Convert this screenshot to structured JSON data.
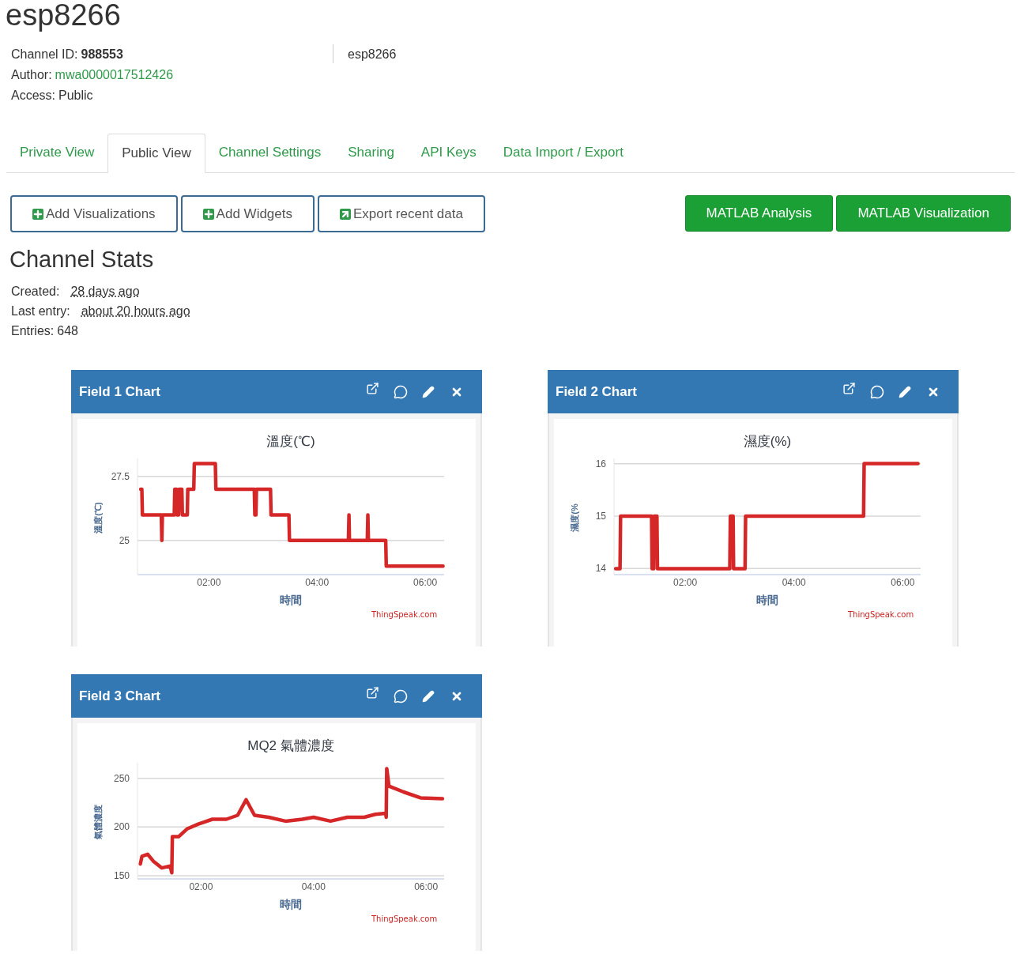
{
  "channel": {
    "title": "esp8266",
    "info": [
      {
        "label": "Channel ID:",
        "value": "988553",
        "kind": "bold"
      },
      {
        "label": "Author:",
        "value": "mwa0000017512426",
        "kind": "link"
      },
      {
        "label": "Access:",
        "value": "Public",
        "kind": "plain"
      }
    ],
    "description": "esp8266"
  },
  "tabs": [
    {
      "label": "Private View",
      "selected": false
    },
    {
      "label": "Public View",
      "selected": true
    },
    {
      "label": "Channel Settings",
      "selected": false
    },
    {
      "label": "Sharing",
      "selected": false
    },
    {
      "label": "API Keys",
      "selected": false
    },
    {
      "label": "Data Import / Export",
      "selected": false
    }
  ],
  "actions": [
    {
      "label": "Add Visualizations",
      "kind": "add"
    },
    {
      "label": "Add Widgets",
      "kind": "add"
    },
    {
      "label": "Export recent data",
      "kind": "export"
    }
  ],
  "matlab_buttons": [
    "MATLAB Analysis",
    "MATLAB Visualization"
  ],
  "stats": {
    "title": "Channel Stats",
    "items": [
      {
        "label": "Created:",
        "value": "28 days ago",
        "kind": "time"
      },
      {
        "label": "Last entry:",
        "value": "about 20 hours ago",
        "kind": "time"
      },
      {
        "label": "Entries:",
        "value": "648",
        "kind": "plain"
      }
    ]
  },
  "widgets": [
    {
      "title": "Field 1 Chart",
      "credit": "ThingSpeak.com",
      "chart_data": {
        "type": "line",
        "title": "溫度(℃)",
        "xlabel": "時間",
        "ylabel": "溫度(℃)",
        "xlim": [
          0.68,
          6.35
        ],
        "ylim": [
          23.7,
          28.2
        ],
        "grid": true,
        "xticks": [
          {
            "value": 2,
            "label": "02:00"
          },
          {
            "value": 4,
            "label": "04:00"
          },
          {
            "value": 6,
            "label": "06:00"
          }
        ],
        "yticks": [
          25,
          27.5
        ],
        "x": [
          0.74,
          0.76,
          0.77,
          1.12,
          1.13,
          1.14,
          1.36,
          1.37,
          1.4,
          1.41,
          1.44,
          1.45,
          1.5,
          1.51,
          1.6,
          1.61,
          1.72,
          1.73,
          2.12,
          2.13,
          2.84,
          2.85,
          2.87,
          2.88,
          3.14,
          3.15,
          3.48,
          3.49,
          4.58,
          4.59,
          4.6,
          4.93,
          4.94,
          4.95,
          5.27,
          5.28,
          6.33
        ],
        "series": [
          {
            "color": "#d62728",
            "values": [
              27,
              27,
              26,
              26,
              25,
              26,
              26,
              27,
              27,
              26,
              26,
              27,
              27,
              26,
              26,
              27,
              27,
              28,
              28,
              27,
              27,
              26,
              26,
              27,
              27,
              26,
              26,
              25,
              25,
              26,
              25,
              25,
              26,
              25,
              25,
              24,
              24
            ]
          }
        ]
      }
    },
    {
      "title": "Field 2 Chart",
      "credit": "ThingSpeak.com",
      "chart_data": {
        "type": "line",
        "title": "濕度(%)",
        "xlabel": "時間",
        "ylabel": "濕度(%",
        "xlim": [
          0.69,
          6.33
        ],
        "ylim": [
          13.9,
          16.1
        ],
        "grid": true,
        "xticks": [
          {
            "value": 2,
            "label": "02:00"
          },
          {
            "value": 4,
            "label": "04:00"
          },
          {
            "value": 6,
            "label": "06:00"
          }
        ],
        "yticks": [
          14,
          15,
          16
        ],
        "x": [
          0.72,
          0.8,
          0.81,
          1.38,
          1.39,
          1.42,
          1.43,
          1.48,
          1.49,
          2.82,
          2.83,
          2.88,
          2.89,
          3.1,
          3.11,
          5.28,
          5.29,
          6.28
        ],
        "series": [
          {
            "color": "#d62728",
            "values": [
              14,
              14,
              15,
              15,
              14,
              14,
              15,
              15,
              14,
              14,
              15,
              15,
              14,
              14,
              15,
              15,
              16,
              16
            ]
          }
        ]
      }
    },
    {
      "title": "Field 3 Chart",
      "credit": "ThingSpeak.com",
      "chart_data": {
        "type": "line",
        "title": "MQ2 氣體濃度",
        "xlabel": "時間",
        "ylabel": "氣體濃度",
        "xlim": [
          0.87,
          6.32
        ],
        "ylim": [
          147.5,
          266
        ],
        "grid": true,
        "xticks": [
          {
            "value": 2,
            "label": "02:00"
          },
          {
            "value": 4,
            "label": "04:00"
          },
          {
            "value": 6,
            "label": "06:00"
          }
        ],
        "yticks": [
          150,
          200,
          250
        ],
        "x": [
          0.92,
          0.95,
          1.05,
          1.15,
          1.3,
          1.45,
          1.48,
          1.49,
          1.6,
          1.75,
          1.95,
          2.2,
          2.45,
          2.65,
          2.8,
          2.95,
          3.2,
          3.5,
          3.8,
          4.0,
          4.3,
          4.6,
          4.9,
          5.1,
          5.28,
          5.29,
          5.3,
          5.34,
          5.6,
          5.9,
          6.29
        ],
        "series": [
          {
            "color": "#d62728",
            "values": [
              162,
              170,
              172,
              165,
              158,
              160,
              153,
              190,
              190,
              198,
              203,
              208,
              208,
              212,
              228,
              212,
              210,
              206,
              208,
              210,
              206,
              210,
              210,
              213,
              214,
              210,
              260,
              242,
              236,
              230,
              229
            ]
          }
        ]
      }
    }
  ]
}
